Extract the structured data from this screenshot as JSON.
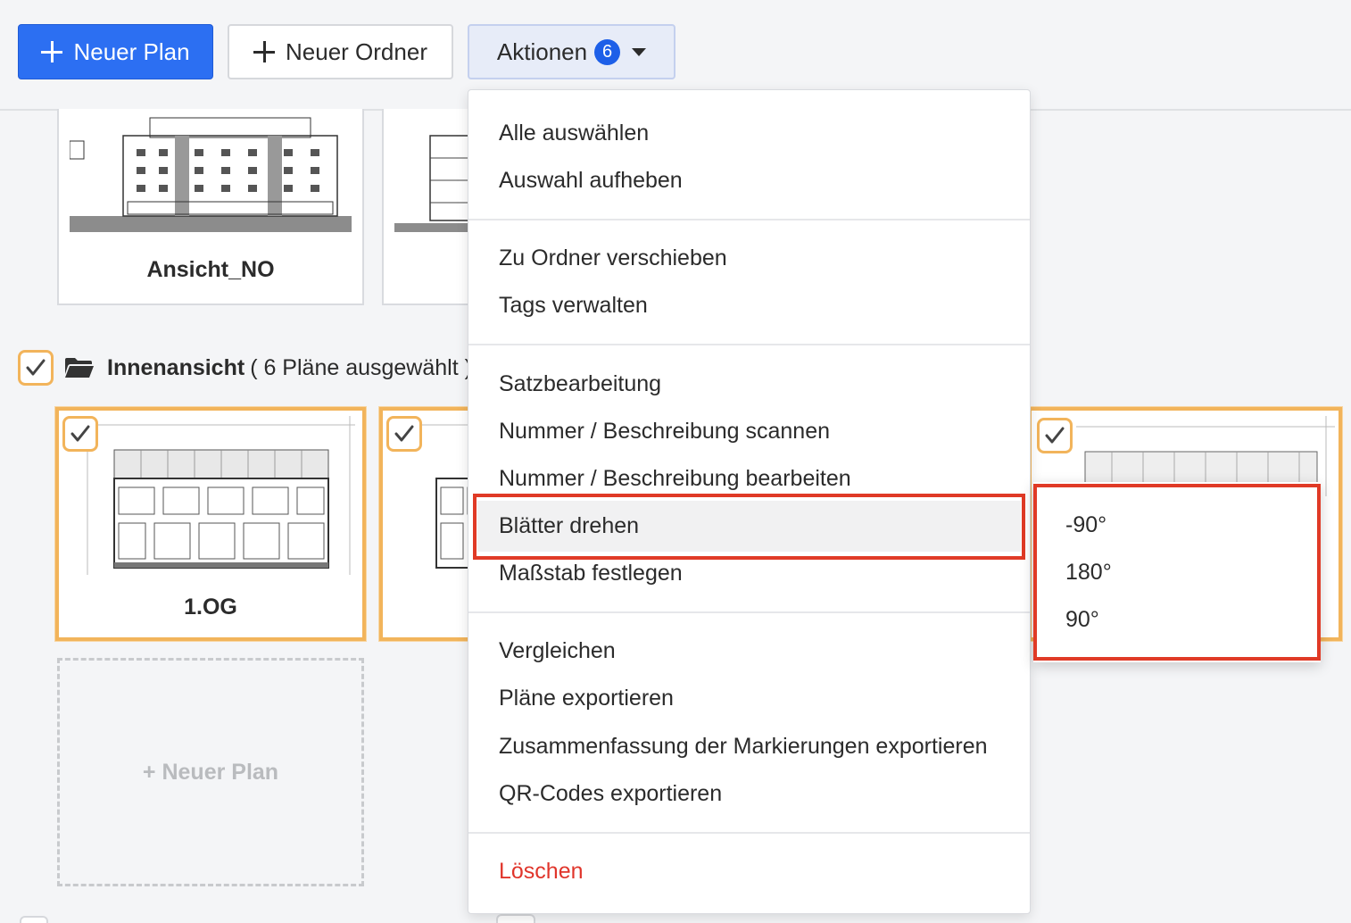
{
  "toolbar": {
    "new_plan": "Neuer Plan",
    "new_folder": "Neuer Ordner",
    "actions": "Aktionen",
    "actions_count": "6"
  },
  "top_cards": [
    {
      "label": "Ansicht_NO"
    },
    {
      "label": ""
    }
  ],
  "folder": {
    "name": "Innenansicht",
    "count_text": "( 6 Pläne ausgewählt )"
  },
  "folder_cards": [
    {
      "label": "1.OG"
    }
  ],
  "new_plan_card": "+ Neuer Plan",
  "menu": {
    "group1": [
      "Alle auswählen",
      "Auswahl aufheben"
    ],
    "group2": [
      "Zu Ordner verschieben",
      "Tags verwalten"
    ],
    "group3": [
      "Satzbearbeitung",
      "Nummer / Beschreibung scannen",
      "Nummer / Beschreibung bearbeiten",
      "Blätter drehen",
      "Maßstab festlegen"
    ],
    "group4": [
      "Vergleichen",
      "Pläne exportieren",
      "Zusammenfassung der Markierungen exportieren",
      "QR-Codes exportieren"
    ],
    "delete": "Löschen"
  },
  "rotate_submenu": [
    "-90°",
    "180°",
    "90°"
  ],
  "colors": {
    "primary": "#2c6ff2",
    "selection": "#f2b45b",
    "highlight_box": "#e03a26",
    "danger": "#e0352b"
  }
}
